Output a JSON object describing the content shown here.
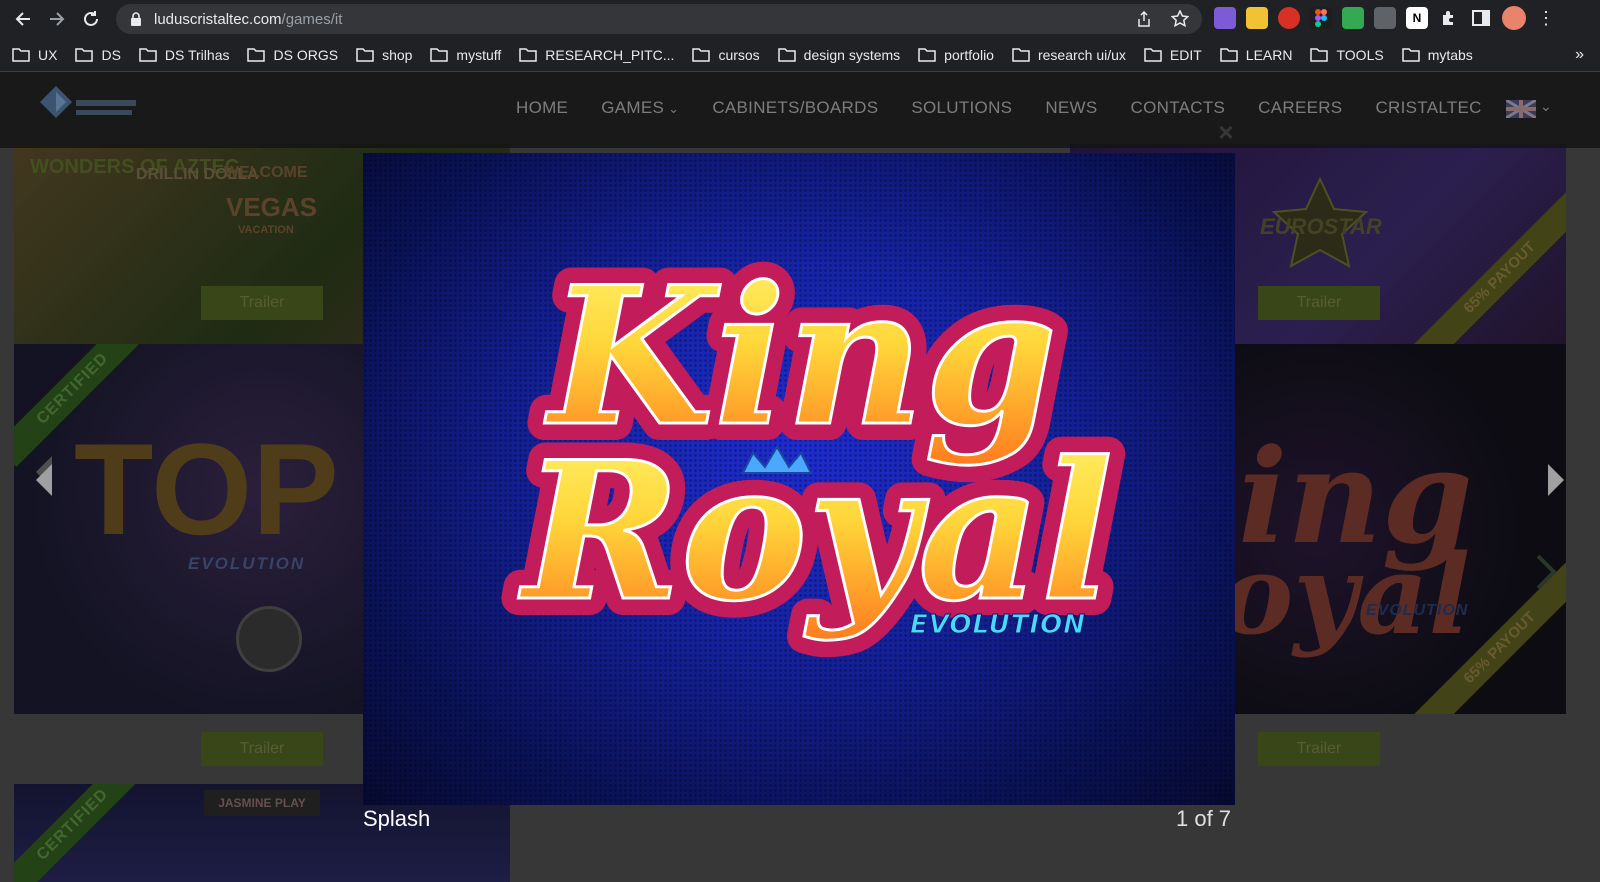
{
  "browser": {
    "url_domain": "luduscristaltec.com",
    "url_path": "/games/it",
    "bookmarks": [
      "UX",
      "DS",
      "DS Trilhas",
      "DS ORGS",
      "shop",
      "mystuff",
      "RESEARCH_PITC...",
      "cursos",
      "design systems",
      "portfolio",
      "research ui/ux",
      "EDIT",
      "LEARN",
      "TOOLS",
      "mytabs"
    ],
    "bookmarks_more": "»"
  },
  "site": {
    "nav": [
      "HOME",
      "GAMES",
      "CABINETS/BOARDS",
      "SOLUTIONS",
      "NEWS",
      "CONTACTS",
      "CAREERS",
      "CRISTALTEC"
    ],
    "games_chevron": "⌄",
    "lang_chevron": "⌄",
    "trailer_label": "Trailer",
    "certified_label": "CERTIFIED",
    "payout_label": "65% PAYOUT",
    "tile_texts": {
      "aztec": "WONDERS OF AZTEC",
      "drill": "DRILLIN DOLLA",
      "vegas_welcome": "WELCOME",
      "vegas": "VEGAS",
      "vegas_vacation": "VACATION",
      "eurostar": "EUROSTAR",
      "top": "TOP",
      "top_evolution": "EVOLUTION",
      "right_evolution": "EVOLUTION",
      "jasmine": "JASMINE PLAY"
    }
  },
  "lightbox": {
    "logo_line1": "King",
    "logo_line2": "Royal",
    "logo_sub": "EVOLUTION",
    "caption": "Splash",
    "counter": "1 of 7",
    "close": "×"
  },
  "colors": {
    "chrome_bg": "#202124",
    "omnibox_bg": "#35363a",
    "trailer_bg": "#4d5e21",
    "logo_yellow": "#ffd63a",
    "logo_orange": "#ff8a1e",
    "logo_outline": "#c21c5a",
    "crown": "#4aa8ff"
  }
}
